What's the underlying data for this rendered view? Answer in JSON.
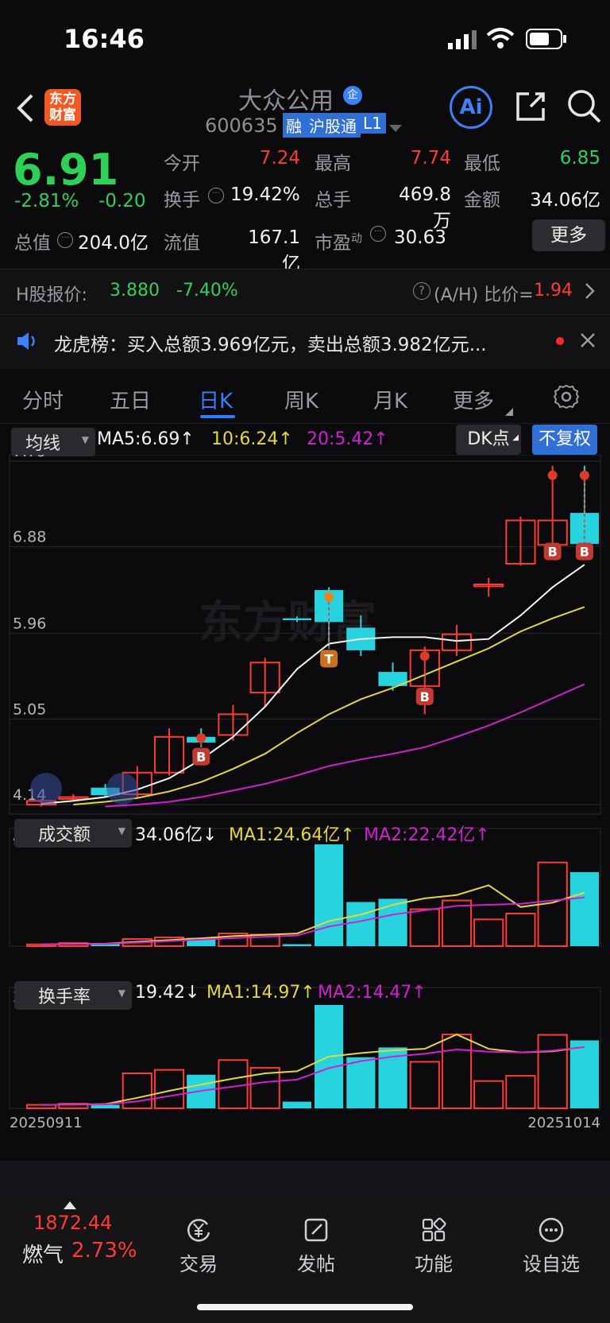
{
  "status": {
    "time": "16:46"
  },
  "header": {
    "logo_line1": "东方",
    "logo_line2": "财富",
    "stock_name": "大众公用",
    "stock_code": "600635",
    "tag_rong": "融",
    "tag_hgt": "沪股通",
    "tag_l1": "L1",
    "ai_label": "Ai"
  },
  "quote": {
    "price": "6.91",
    "change_pct": "-2.81%",
    "change_abs": "-0.20",
    "open_label": "今开",
    "open": "7.24",
    "high_label": "最高",
    "high": "7.74",
    "low_label": "最低",
    "low": "6.85",
    "turnover_label": "换手",
    "turnover": "19.42%",
    "volume_label": "总手",
    "volume": "469.8万",
    "amount_label": "金额",
    "amount": "34.06亿",
    "mktcap_label": "总值",
    "mktcap": "204.0亿",
    "float_label": "流值",
    "float": "167.1亿",
    "pe_label": "市盈",
    "pe_sup": "动",
    "pe": "30.63",
    "more_label": "更多"
  },
  "hshare": {
    "label": "H股报价:",
    "price": "3.880",
    "change": "-7.40%",
    "ratio_label": "(A/H) 比价=",
    "ratio": "1.94"
  },
  "notice": {
    "text": "龙虎榜：买入总额3.969亿元，卖出总额3.982亿元..."
  },
  "tabs": [
    "分时",
    "五日",
    "日K",
    "周K",
    "月K",
    "更多"
  ],
  "kline": {
    "ma_selector": "均线",
    "ma5": "MA5:6.69↑",
    "ma10": "10:6.24↑",
    "ma20": "20:5.42↑",
    "dk_label": "DK点",
    "fq_label": "不复权",
    "y_ticks": [
      "7.79",
      "6.88",
      "5.96",
      "5.05",
      "4.14"
    ],
    "watermark": "东方财富"
  },
  "amount_panel": {
    "selector": "成交额",
    "value": "34.06亿↓",
    "ma1": "MA1:24.64亿↑",
    "ma2": "MA2:22.42亿↑",
    "max_label": "46.82亿"
  },
  "turn_panel": {
    "selector": "换手率",
    "value": "19.42↓",
    "ma1": "MA1:14.97↑",
    "ma2": "MA2:14.47↑",
    "max_label": "29.54",
    "date_start": "20250911",
    "date_end": "20251014"
  },
  "colors": {
    "up": "#ff3b30",
    "down": "#27d3df",
    "accent": "#2f7dff",
    "ma5": "#f2f2f2",
    "ma10": "#e7d63a",
    "ma20": "#d21fd0"
  },
  "chart_data": {
    "type": "candlestick",
    "candles": [
      {
        "o": 4.14,
        "c": 4.18,
        "h": 4.2,
        "l": 4.12
      },
      {
        "o": 4.2,
        "c": 4.22,
        "h": 4.25,
        "l": 4.18
      },
      {
        "o": 4.32,
        "c": 4.24,
        "h": 4.36,
        "l": 4.22
      },
      {
        "o": 4.25,
        "c": 4.48,
        "h": 4.55,
        "l": 4.22
      },
      {
        "o": 4.48,
        "c": 4.86,
        "h": 4.95,
        "l": 4.45
      },
      {
        "o": 4.86,
        "c": 4.8,
        "h": 4.95,
        "l": 4.75
      },
      {
        "o": 4.88,
        "c": 5.1,
        "h": 5.2,
        "l": 4.82
      },
      {
        "o": 5.33,
        "c": 5.65,
        "h": 5.7,
        "l": 5.18
      },
      {
        "o": 6.12,
        "c": 6.1,
        "h": 6.14,
        "l": 6.08
      },
      {
        "o": 6.42,
        "c": 6.08,
        "h": 6.45,
        "l": 5.82
      },
      {
        "o": 6.02,
        "c": 5.78,
        "h": 6.15,
        "l": 5.72
      },
      {
        "o": 5.55,
        "c": 5.4,
        "h": 5.65,
        "l": 5.35
      },
      {
        "o": 5.4,
        "c": 5.78,
        "h": 5.82,
        "l": 5.1
      },
      {
        "o": 5.78,
        "c": 5.95,
        "h": 6.05,
        "l": 5.72
      },
      {
        "o": 6.46,
        "c": 6.48,
        "h": 6.55,
        "l": 6.35
      },
      {
        "o": 6.7,
        "c": 7.16,
        "h": 7.2,
        "l": 6.68
      },
      {
        "o": 6.9,
        "c": 7.16,
        "h": 7.74,
        "l": 6.85
      },
      {
        "o": 7.24,
        "c": 6.91,
        "h": 7.74,
        "l": 6.85
      }
    ],
    "ma5": [
      4.15,
      4.18,
      4.22,
      4.3,
      4.42,
      4.62,
      4.86,
      5.18,
      5.58,
      5.85,
      5.9,
      5.92,
      5.92,
      5.88,
      5.9,
      6.15,
      6.45,
      6.69
    ],
    "ma10": [
      null,
      4.14,
      4.17,
      4.21,
      4.28,
      4.38,
      4.52,
      4.68,
      4.9,
      5.1,
      5.26,
      5.38,
      5.52,
      5.66,
      5.8,
      5.98,
      6.12,
      6.24
    ],
    "ma20": [
      null,
      null,
      4.12,
      4.14,
      4.17,
      4.22,
      4.29,
      4.36,
      4.45,
      4.55,
      4.62,
      4.68,
      4.75,
      4.86,
      4.98,
      5.12,
      5.27,
      5.42
    ],
    "markers": [
      {
        "i": 5,
        "label": "B",
        "price": 4.98
      },
      {
        "i": 9,
        "label": "T",
        "price": 6.02
      },
      {
        "i": 12,
        "label": "B",
        "price": 5.62
      },
      {
        "i": 16,
        "label": "B",
        "price": 7.16
      },
      {
        "i": 17,
        "label": "B",
        "price": 7.16
      }
    ],
    "amount": [
      0.8,
      1.4,
      1.0,
      3.3,
      4.0,
      3.8,
      5.8,
      5.3,
      0.9,
      46.82,
      20.3,
      21.8,
      17.0,
      21.0,
      12.3,
      15.0,
      38.5,
      34.06
    ],
    "amount_ma1": [
      0.8,
      1.0,
      1.1,
      2.0,
      2.8,
      3.6,
      4.6,
      5.2,
      5.8,
      11.5,
      14.5,
      19.0,
      22.0,
      23.5,
      28.0,
      18.0,
      20.0,
      24.64
    ],
    "amount_ma2": [
      0.8,
      0.9,
      1.0,
      1.6,
      2.3,
      3.0,
      3.7,
      4.3,
      4.9,
      9.0,
      11.5,
      14.5,
      16.5,
      18.5,
      19.0,
      19.5,
      21.0,
      22.42
    ],
    "turnover": [
      1.0,
      1.3,
      1.0,
      10.0,
      11.0,
      9.6,
      13.8,
      11.6,
      1.9,
      29.54,
      14.6,
      17.4,
      13.3,
      21.1,
      7.8,
      9.3,
      21.0,
      19.42
    ],
    "turn_ma1": [
      1.0,
      1.1,
      1.2,
      3.0,
      5.0,
      6.8,
      8.5,
      10.0,
      10.6,
      14.8,
      15.8,
      16.6,
      17.0,
      21.1,
      17.0,
      16.0,
      16.3,
      17.5
    ],
    "turn_ma2": [
      1.0,
      1.05,
      1.1,
      2.0,
      3.5,
      5.0,
      6.2,
      7.5,
      8.2,
      11.5,
      13.5,
      14.8,
      15.6,
      16.8,
      16.2,
      16.0,
      16.5,
      17.5
    ]
  },
  "bottom": {
    "index_value": "1872.44",
    "index_name": "燃气",
    "index_change": "2.73%",
    "nav": [
      "交易",
      "发帖",
      "功能",
      "设自选"
    ]
  }
}
